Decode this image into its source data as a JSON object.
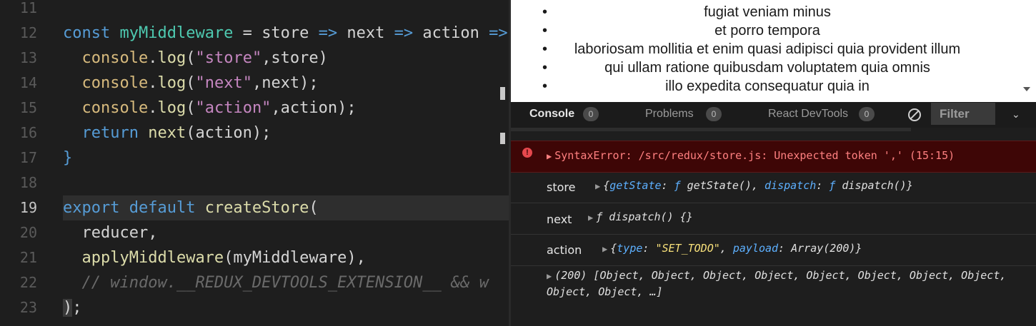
{
  "editor": {
    "lines": [
      {
        "num": "11",
        "tokens": []
      },
      {
        "num": "12",
        "tokens": [
          [
            "kw",
            "const "
          ],
          [
            "def",
            "myMiddleware"
          ],
          [
            "plain",
            " = "
          ],
          [
            "plain",
            "store "
          ],
          [
            "kw",
            "=> "
          ],
          [
            "plain",
            "next "
          ],
          [
            "kw",
            "=> "
          ],
          [
            "plain",
            "action "
          ],
          [
            "kw",
            "=>"
          ]
        ]
      },
      {
        "num": "13",
        "tokens": [
          [
            "plain",
            "  "
          ],
          [
            "obj",
            "console"
          ],
          [
            "plain",
            "."
          ],
          [
            "meth",
            "log"
          ],
          [
            "plain",
            "("
          ],
          [
            "str",
            "\"store\""
          ],
          [
            "plain",
            ",store)"
          ]
        ]
      },
      {
        "num": "14",
        "tokens": [
          [
            "plain",
            "  "
          ],
          [
            "obj",
            "console"
          ],
          [
            "plain",
            "."
          ],
          [
            "meth",
            "log"
          ],
          [
            "plain",
            "("
          ],
          [
            "str",
            "\"next\""
          ],
          [
            "plain",
            ",next);"
          ]
        ]
      },
      {
        "num": "15",
        "tokens": [
          [
            "plain",
            "  "
          ],
          [
            "obj",
            "console"
          ],
          [
            "plain",
            "."
          ],
          [
            "meth",
            "log"
          ],
          [
            "plain",
            "("
          ],
          [
            "str",
            "\"action\""
          ],
          [
            "plain",
            ",action);"
          ]
        ]
      },
      {
        "num": "16",
        "tokens": [
          [
            "plain",
            "  "
          ],
          [
            "kw",
            "return "
          ],
          [
            "fn",
            "next"
          ],
          [
            "plain",
            "(action);"
          ]
        ]
      },
      {
        "num": "17",
        "tokens": [
          [
            "brace",
            "}"
          ]
        ]
      },
      {
        "num": "18",
        "tokens": []
      },
      {
        "num": "19",
        "tokens": [
          [
            "kw",
            "export "
          ],
          [
            "kw",
            "default "
          ],
          [
            "fn",
            "createStore"
          ],
          [
            "plain",
            "("
          ]
        ],
        "active": true
      },
      {
        "num": "20",
        "tokens": [
          [
            "plain",
            "  reducer,"
          ]
        ]
      },
      {
        "num": "21",
        "tokens": [
          [
            "plain",
            "  "
          ],
          [
            "fn",
            "applyMiddleware"
          ],
          [
            "plain",
            "(myMiddleware),"
          ]
        ]
      },
      {
        "num": "22",
        "tokens": [
          [
            "plain",
            "  "
          ],
          [
            "cmt",
            "// window.__REDUX_DEVTOOLS_EXTENSION__ && w"
          ]
        ]
      },
      {
        "num": "23",
        "tokens": [
          [
            "cursor-paren",
            ")"
          ],
          [
            "plain",
            ";"
          ]
        ]
      }
    ]
  },
  "preview": {
    "items": [
      "fugiat veniam minus",
      "et porro tempora",
      "laboriosam mollitia et enim quasi adipisci quia provident illum",
      "qui ullam ratione quibusdam voluptatem quia omnis",
      "illo expedita consequatur quia in"
    ]
  },
  "devtools": {
    "tabs": [
      {
        "label": "Console",
        "badge": "0"
      },
      {
        "label": "Problems",
        "badge": "0"
      },
      {
        "label": "React DevTools",
        "badge": "0"
      }
    ],
    "filter_label": "Filter",
    "error_icon": "!",
    "error_text": "SyntaxError: /src/redux/store.js: Unexpected token ',' (15:15)",
    "logs": {
      "store_label": "store",
      "next_label": "next",
      "action_label": "action",
      "next_value": "ƒ dispatch() {}",
      "array_value": "(200) [Object, Object, Object, Object, Object, Object, Object, Object, Object, Object, …]",
      "store_tokens": [
        [
          "plain",
          "{"
        ],
        [
          "k",
          "getState"
        ],
        [
          "plain",
          ": "
        ],
        [
          "f",
          "ƒ"
        ],
        [
          "plain",
          " getState(), "
        ],
        [
          "k",
          "dispatch"
        ],
        [
          "plain",
          ": "
        ],
        [
          "f",
          "ƒ"
        ],
        [
          "plain",
          " dispatch()}"
        ]
      ],
      "action_tokens": [
        [
          "plain",
          "{"
        ],
        [
          "k",
          "type"
        ],
        [
          "plain",
          ": "
        ],
        [
          "s",
          "\"SET_TODO\""
        ],
        [
          "plain",
          ", "
        ],
        [
          "k",
          "payload"
        ],
        [
          "plain",
          ": Array(200)}"
        ]
      ]
    }
  },
  "icons": {
    "clear-console-icon": "no-entry",
    "filter-chevron-icon": "chevron-down",
    "expand-icon": "triangle-right",
    "error-icon": "circle-exclamation"
  }
}
